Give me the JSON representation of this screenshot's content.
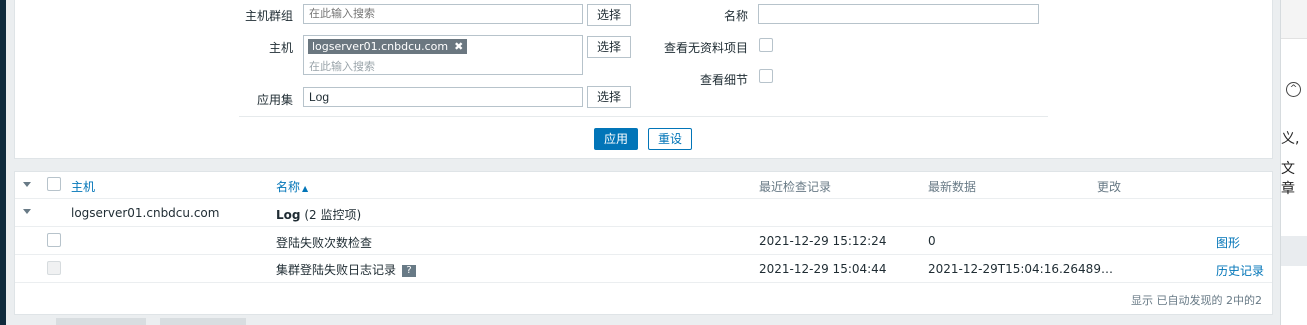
{
  "filter": {
    "host_groups": {
      "label": "主机群组",
      "placeholder": "在此输入搜索",
      "select": "选择"
    },
    "hosts": {
      "label": "主机",
      "tag": "logserver01.cnbdcu.com",
      "tag_remove": "✖",
      "placeholder": "在此输入搜索",
      "select": "选择"
    },
    "application": {
      "label": "应用集",
      "value": "Log",
      "select": "选择"
    },
    "name": {
      "label": "名称",
      "value": ""
    },
    "show_no_data": {
      "label": "查看无资料项目",
      "checked": false
    },
    "show_details": {
      "label": "查看细节",
      "checked": false
    },
    "apply": "应用",
    "reset": "重设"
  },
  "table": {
    "columns": {
      "host": "主机",
      "name": "名称",
      "sort_arrow": "▲",
      "last_check": "最近检查记录",
      "last_value": "最新数据",
      "change": "更改"
    },
    "group": {
      "host": "logserver01.cnbdcu.com",
      "app": "Log",
      "count": "(2 监控项)"
    },
    "rows": [
      {
        "name": "登陆失败次数检查",
        "last_check": "2021-12-29 15:12:24",
        "last_value": "0",
        "action": "图形"
      },
      {
        "name": "集群登陆失败日志记录",
        "help": "?",
        "last_check": "2021-12-29 15:04:44",
        "last_value": "2021-12-29T15:04:16.26489…",
        "action": "历史记录"
      }
    ],
    "footer": "显示 已自动发现的 2中的2"
  },
  "side": {
    "text1": "义,",
    "text2": "文章",
    "chevron": "^"
  }
}
